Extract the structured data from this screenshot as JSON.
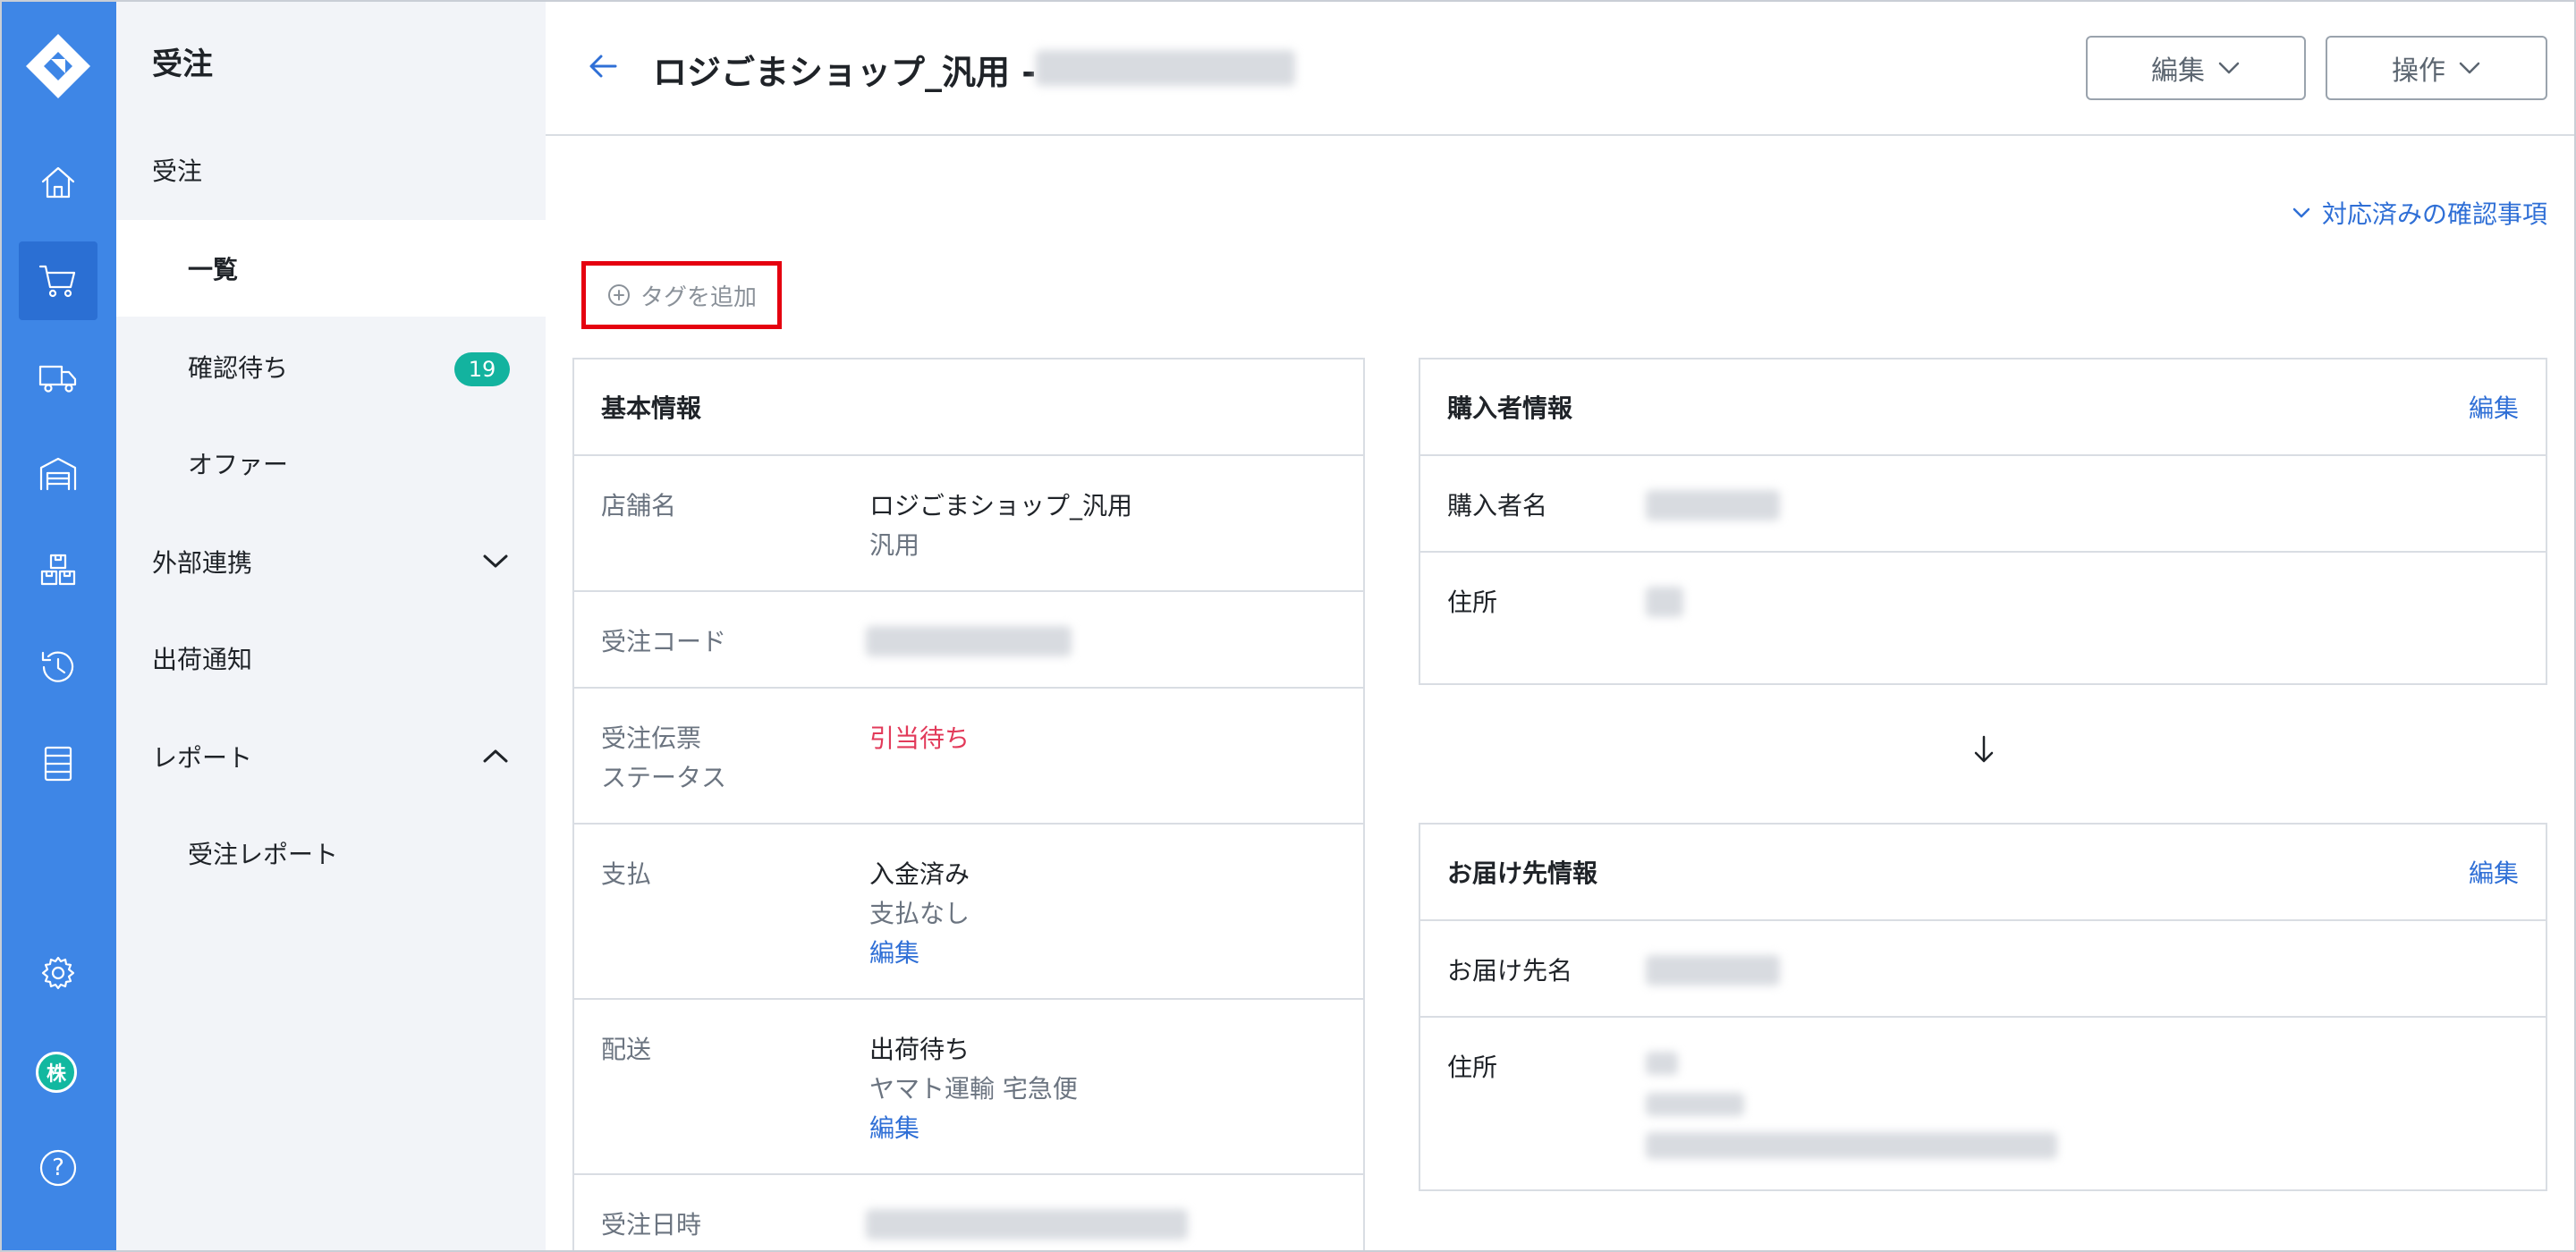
{
  "rail": {
    "items": [
      {
        "icon": "home-icon"
      },
      {
        "icon": "cart-icon",
        "active": true
      },
      {
        "icon": "truck-icon"
      },
      {
        "icon": "warehouse-icon"
      },
      {
        "icon": "boxes-icon"
      },
      {
        "icon": "history-icon"
      },
      {
        "icon": "list-icon"
      },
      {
        "icon": "gear-icon"
      },
      {
        "icon": "help-icon"
      }
    ],
    "avatar_char": "株",
    "help_char": "?"
  },
  "subnav": {
    "title": "受注",
    "items": [
      {
        "label": "受注"
      },
      {
        "label": "一覧",
        "selected": true
      },
      {
        "label": "確認待ち",
        "badge": "19"
      },
      {
        "label": "オファー"
      },
      {
        "label": "外部連携",
        "chevron": "down"
      },
      {
        "label": "出荷通知"
      },
      {
        "label": "レポート",
        "chevron": "up"
      },
      {
        "label": "受注レポート"
      }
    ]
  },
  "header": {
    "title": "ロジごまショップ_汎用 -",
    "edit_button": "編集",
    "action_button": "操作"
  },
  "resolved_link": "対応済みの確認事項",
  "add_tag": "タグを追加",
  "basic_info": {
    "title": "基本情報",
    "store_label": "店舗名",
    "store_name": "ロジごまショップ_汎用",
    "store_sub": "汎用",
    "order_code_label": "受注コード",
    "status_label_1": "受注伝票",
    "status_label_2": "ステータス",
    "status_value": "引当待ち",
    "payment_label": "支払",
    "payment_status": "入金済み",
    "payment_sub": "支払なし",
    "payment_edit": "編集",
    "shipping_label": "配送",
    "shipping_status": "出荷待ち",
    "shipping_carrier": "ヤマト運輸 宅急便",
    "shipping_edit": "編集",
    "order_date_label": "受注日時"
  },
  "buyer_info": {
    "title": "購入者情報",
    "edit": "編集",
    "name_label": "購入者名",
    "address_label": "住所"
  },
  "delivery_info": {
    "title": "お届け先情報",
    "edit": "編集",
    "name_label": "お届け先名",
    "address_label": "住所"
  },
  "colors": {
    "rail_bg": "#3e86e6",
    "accent": "#2f6fd6",
    "badge": "#13b39f",
    "alert": "#e23a5a",
    "highlight": "#e5000f"
  }
}
